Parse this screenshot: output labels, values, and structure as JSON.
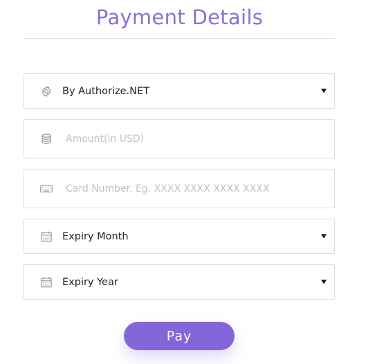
{
  "title": "Payment Details",
  "gateway_select": {
    "value": "By Authorize.NET",
    "icon": "gear-icon"
  },
  "amount_field": {
    "value": "",
    "placeholder": "Amount(in USD)",
    "icon": "coin-stack-icon"
  },
  "card_field": {
    "value": "",
    "placeholder": "Card Number. Eg. XXXX XXXX XXXX XXXX",
    "icon": "keyboard-icon"
  },
  "expiry_month_select": {
    "value": "Expiry Month",
    "icon": "calendar-icon"
  },
  "expiry_year_select": {
    "value": "Expiry Year",
    "icon": "calendar-icon"
  },
  "pay_button": {
    "label": "Pay"
  },
  "colors": {
    "accent": "#8566d9",
    "title": "#8c6fd6",
    "border": "#dcdcdc",
    "placeholder": "#c2c2c2"
  }
}
